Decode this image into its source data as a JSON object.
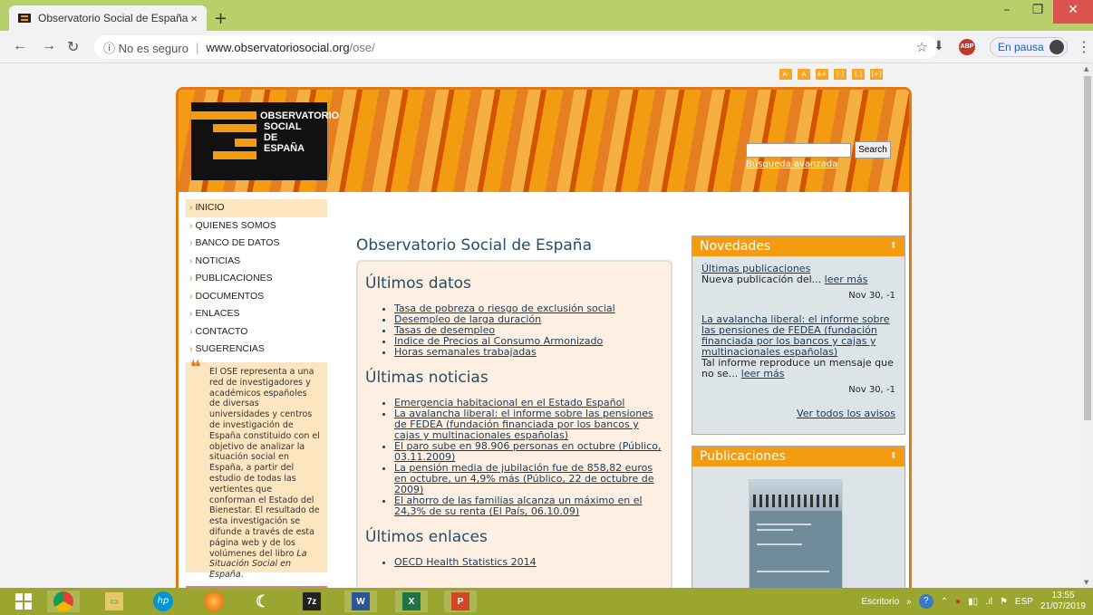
{
  "browser": {
    "tab_title": "Observatorio Social de España",
    "tab_close": "×",
    "new_tab": "+",
    "security_label": "ⓘ No es seguro",
    "url_host": "www.observatoriosocial.org",
    "url_path": "/ose/",
    "profile_label": "En pausa",
    "abp_label": "ABP"
  },
  "site": {
    "size_buttons": [
      "A-",
      "A",
      "A+",
      "[-]",
      "[.]",
      "[+]"
    ],
    "logo_lines": [
      "OBSERVATORIO",
      "SOCIAL",
      "DE",
      "ESPAÑA"
    ],
    "search_button": "Search",
    "search_advanced": "Búsqueda avanzada",
    "nav": [
      "INICIO",
      "QUIENES SOMOS",
      "BANCO DE DATOS",
      "NOTICIAS",
      "PUBLICACIONES",
      "DOCUMENTOS",
      "ENLACES",
      "CONTACTO",
      "SUGERENCIAS"
    ],
    "quote_text": "El OSE representa a una red de investigadores y académicos españoles de diversas universidades y centros de investigación de España constituido con el objetivo de analizar la situación social en España, a partir del estudio de todas las vertientes que conforman el Estado del Bienestar. El resultado de esta investigación se difunde a través de esta página web y de los volúmenes del libro",
    "quote_book": "La Situación Social en España",
    "quote_end": ".",
    "page_title": "Observatorio Social de España",
    "sections": {
      "datos_title": "Últimos datos",
      "datos": [
        "Tasa de pobreza o riesgo de exclusión social",
        "Desempleo de larga duración",
        "Tasas de desempleo",
        "Indice de Precios al Consumo Armonizado",
        "Horas semanales trabajadas"
      ],
      "noticias_title": "Últimas noticias",
      "noticias": [
        "Emergencia habitacional en el Estado Español",
        "La avalancha liberal: el informe sobre las pensiones de FEDEA (fundación financiada por los bancos y cajas y multinacionales españolas)",
        "El paro sube en 98.906 personas en octubre (Público, 03.11.2009)",
        "La pensión media de jubilación fue de 858,82 euros en octubre, un 4,9% más (Público, 22 de octubre de 2009)",
        "El ahorro de las familias alcanza un máximo en el 24,3% de su renta (El País, 06.10.09)"
      ],
      "enlaces_title": "Últimos enlaces",
      "enlaces": [
        "OECD Health Statistics 2014"
      ]
    },
    "novedades": {
      "title": "Novedades",
      "item1_link": "Últimas publicaciones",
      "item1_text": "Nueva publicación del...",
      "item1_more": "leer más",
      "item1_date": "Nov 30, -1",
      "item2_link": "La avalancha liberal: el informe sobre las pensiones de FEDEA (fundación financiada por los bancos y cajas y multinacionales españolas)",
      "item2_text": "Tal informe reproduce un mensaje que no se...",
      "item2_more": "leer más",
      "item2_date": "Nov 30, -1",
      "all": "Ver todos los avisos"
    },
    "publicaciones_title": "Publicaciones"
  },
  "taskbar": {
    "desktop_label": "Escritorio",
    "lang": "ESP",
    "time": "13:55",
    "date": "21/07/2019",
    "apps": [
      "7z",
      "W",
      "X",
      "P"
    ]
  }
}
